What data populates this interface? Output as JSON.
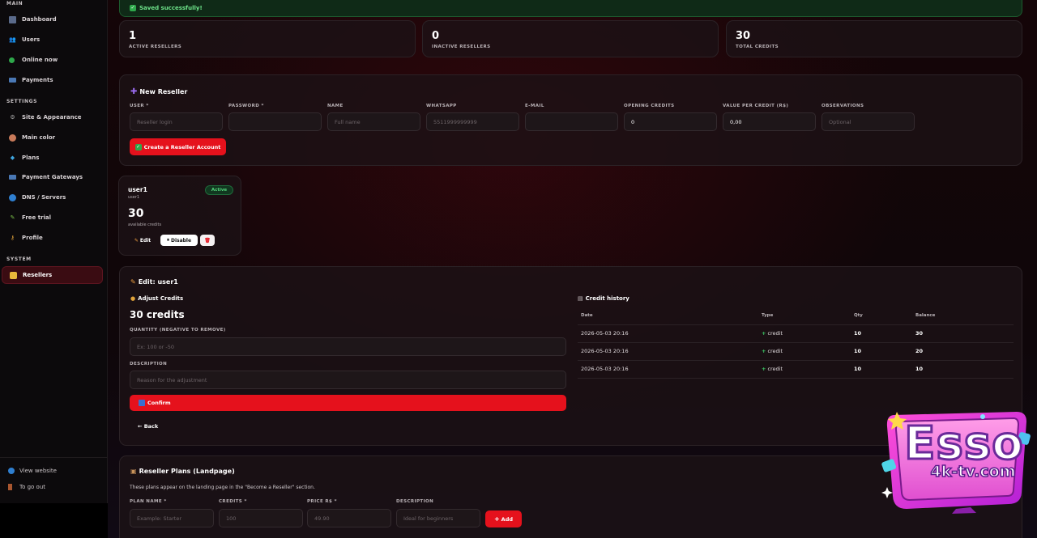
{
  "sidebar": {
    "sections": {
      "main": "MAIN",
      "settings": "SETTINGS",
      "system": "SYSTEM"
    },
    "items": [
      {
        "label": "Dashboard",
        "icon": "dashboard-icon"
      },
      {
        "label": "Users",
        "icon": "users-icon"
      },
      {
        "label": "Online now",
        "icon": "online-dot-icon"
      },
      {
        "label": "Payments",
        "icon": "card-icon"
      },
      {
        "label": "Site & Appearance",
        "icon": "gear-icon"
      },
      {
        "label": "Main color",
        "icon": "palette-icon"
      },
      {
        "label": "Plans",
        "icon": "diamond-icon"
      },
      {
        "label": "Payment Gateways",
        "icon": "card-icon"
      },
      {
        "label": "DNS / Servers",
        "icon": "globe-icon"
      },
      {
        "label": "Free trial",
        "icon": "pencil-icon"
      },
      {
        "label": "Profile",
        "icon": "key-icon"
      },
      {
        "label": "Resellers",
        "icon": "handshake-icon"
      }
    ],
    "footer": {
      "view_website": "View website",
      "go_out": "To go out"
    }
  },
  "toast": {
    "message": "Saved successfully!"
  },
  "stats": [
    {
      "value": "1",
      "label": "ACTIVE RESELLERS"
    },
    {
      "value": "0",
      "label": "INACTIVE RESELLERS"
    },
    {
      "value": "30",
      "label": "TOTAL CREDITS"
    }
  ],
  "new_reseller": {
    "title": "New Reseller",
    "fields": {
      "user": {
        "label": "USER *",
        "placeholder": "Reseller login",
        "value": ""
      },
      "password": {
        "label": "PASSWORD *",
        "placeholder": "",
        "value": ""
      },
      "name": {
        "label": "NAME",
        "placeholder": "Full name",
        "value": ""
      },
      "whatsapp": {
        "label": "WHATSAPP",
        "placeholder": "5511999999999",
        "value": ""
      },
      "email": {
        "label": "E-MAIL",
        "placeholder": "",
        "value": ""
      },
      "opening_credits": {
        "label": "OPENING CREDITS",
        "placeholder": "",
        "value": "0"
      },
      "value_per_credit": {
        "label": "VALUE PER CREDIT (R$)",
        "placeholder": "",
        "value": "0,00"
      },
      "observations": {
        "label": "OBSERVATIONS",
        "placeholder": "Optional",
        "value": ""
      }
    },
    "create_button": "Create a Reseller Account"
  },
  "reseller_card": {
    "name": "user1",
    "login": "user1",
    "status": "Active",
    "credits": "30",
    "credits_caption": "available credits",
    "edit_label": "Edit",
    "disable_label": "Disable"
  },
  "edit_panel": {
    "title": "Edit: user1",
    "adjust_title": "Adjust Credits",
    "credits_display": "30 credits",
    "quantity_label": "QUANTITY (NEGATIVE TO REMOVE)",
    "quantity_placeholder": "Ex: 100 or -50",
    "description_label": "DESCRIPTION",
    "description_placeholder": "Reason for the adjustment",
    "confirm_label": "Confirm",
    "back_label": "← Back",
    "history_title": "Credit history",
    "history_columns": [
      "Date",
      "Type",
      "Qty",
      "Balance"
    ],
    "history_rows": [
      {
        "date": "2026-05-03 20:16",
        "type": "credit",
        "qty": "10",
        "balance": "30"
      },
      {
        "date": "2026-05-03 20:16",
        "type": "credit",
        "qty": "10",
        "balance": "20"
      },
      {
        "date": "2026-05-03 20:16",
        "type": "credit",
        "qty": "10",
        "balance": "10"
      }
    ]
  },
  "plans": {
    "title": "Reseller Plans (Landpage)",
    "subtitle": "These plans appear on the landing page in the \"Become a Reseller\" section.",
    "fields": {
      "plan_name": {
        "label": "PLAN NAME *",
        "placeholder": "Example: Starter"
      },
      "credits": {
        "label": "CREDITS *",
        "placeholder": "100"
      },
      "price": {
        "label": "PRICE R$ *",
        "placeholder": "49.90"
      },
      "description": {
        "label": "DESCRIPTION",
        "placeholder": "Ideal for beginners"
      }
    },
    "add_label": "Add"
  },
  "logo": {
    "line1": "Esso",
    "line2": "4k-tv.com"
  },
  "colors": {
    "accent": "#e5111c",
    "success": "#3fd46b"
  }
}
